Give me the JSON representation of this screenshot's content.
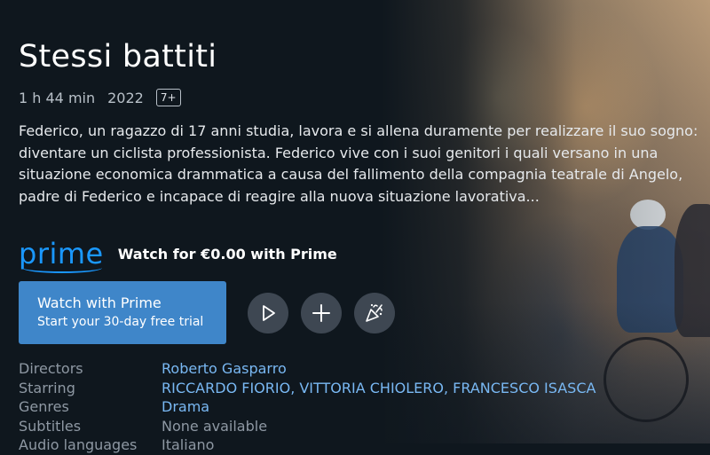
{
  "movie": {
    "title": "Stessi battiti",
    "duration": "1 h 44 min",
    "year": "2022",
    "age_rating": "7+",
    "synopsis": "Federico, un ragazzo di 17 anni studia, lavora e si allena duramente per realizzare il suo sogno: diventare un ciclista professionista. Federico vive con i suoi genitori i quali versano in una situazione economica drammatica a causa del fallimento della compagnia teatrale di Angelo, padre di Federico e incapace di reagire alla nuova situazione lavorativa..."
  },
  "prime": {
    "logo_text": "prime",
    "offer": "Watch for €0.00 with Prime"
  },
  "actions": {
    "watch_label": "Watch with Prime",
    "watch_sub": "Start your 30-day free trial",
    "trailer_icon": "play-icon",
    "watchlist_icon": "plus-icon",
    "party_icon": "party-popper-icon"
  },
  "details": [
    {
      "label": "Directors",
      "value": "Roberto Gasparro",
      "link": true
    },
    {
      "label": "Starring",
      "value": "RICCARDO FIORIO, VITTORIA CHIOLERO, FRANCESCO ISASCA",
      "link": true
    },
    {
      "label": "Genres",
      "value": "Drama",
      "link": true
    },
    {
      "label": "Subtitles",
      "value": "None available",
      "link": false
    },
    {
      "label": "Audio languages",
      "value": "Italiano",
      "link": false
    }
  ],
  "colors": {
    "background": "#0f171e",
    "prime_blue": "#1a98ff",
    "button_blue": "#3f86c9",
    "link": "#79b8f3",
    "muted": "#8e98a3"
  }
}
